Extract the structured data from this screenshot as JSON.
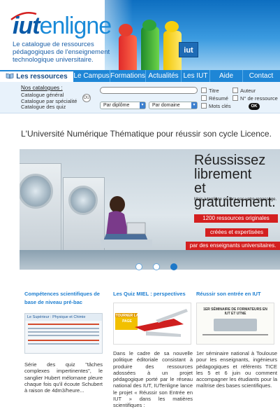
{
  "header": {
    "logo_iut": "iut",
    "logo_enligne": "enligne",
    "tagline": "Le catalogue de ressources pédagogiques de l'enseignement technologique universitaire.",
    "badge": "iut"
  },
  "nav": {
    "items": [
      {
        "label": "Les ressources",
        "active": true
      },
      {
        "label": "Le Campus"
      },
      {
        "label": "Formations"
      },
      {
        "label": "Actualités"
      },
      {
        "label": "Les IUT"
      },
      {
        "label": "Aide"
      },
      {
        "label": "Contact"
      }
    ]
  },
  "search": {
    "catalogues_label": "Nos catalogues :",
    "catalogues": [
      "Catalogue général",
      "Catalogue par spécialité",
      "Catalogue des quiz"
    ],
    "ou_label": "OU",
    "query_value": "",
    "select_diplome": "Par diplôme",
    "select_domaine": "Par domaine",
    "checks": [
      "Titre",
      "Auteur",
      "Résumé",
      "N° de ressource",
      "Mots clés"
    ],
    "ok_label": "OK"
  },
  "headline": "L'Université Numérique Thématique pour réussir son cycle Licence.",
  "hero": {
    "title_lines": [
      "Réussissez",
      "librement",
      "et gratuitement."
    ],
    "subline": "Mais iutenligne ne fera pas votre repassage.",
    "tags": [
      "1200 ressources originales",
      "créées et expertisées",
      "par des enseignants universitaires."
    ],
    "slides": 3,
    "active_slide": 3
  },
  "columns": [
    {
      "title": "Compétences scientifiques de base de niveau pré-bac",
      "image_caption": "Le Supérieur : Physique et Chimie",
      "text": "Série des quiz \"tâches complexes impertinentes\", le sanglier Hubert mélomane pleure chaque fois qu'il écoute Schubert à raison de 4dm3/heure..."
    },
    {
      "title": "Les Quiz MIEL : perspectives",
      "image_caption": "TOURNER LA PAGE",
      "text": "Dans le cadre de sa nouvelle politique éditoriale consistant à produire des ressources adossées à un projet pédagogique porté par le réseau national des IUT, IUTenligne lance le projet « Réussir son Entrée en IUT » dans les matières scientifiques :"
    },
    {
      "title": "Réussir son entrée en IUT",
      "image_caption": "1ER SÉMINAIRE DE FORMATEURS EN IUT ET UTNE",
      "text": "1er séminaire national à Toulouse pour les enseignants, ingénieurs pédagogiques et référents TICE les 5 et 6 juin ou comment accompagner les étudiants pour la maîtrise des bases scientifiques."
    }
  ]
}
